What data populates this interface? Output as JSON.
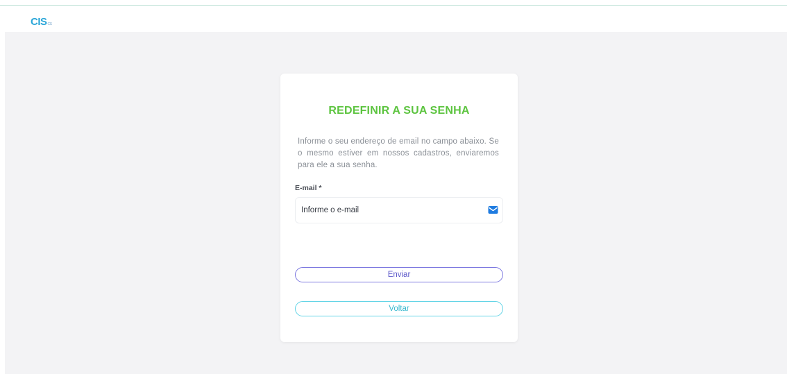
{
  "header": {
    "logo_text": "CIS",
    "logo_sub": "CS"
  },
  "card": {
    "title": "REDEFINIR A SUA SENHA",
    "description": "Informe o seu endereço de email no campo abaixo. Se o mesmo estiver em nossos cadastros, enviaremos para ele a sua senha.",
    "email_label": "E-mail *",
    "email_placeholder": "Informe o e-mail",
    "email_value": "",
    "email_icon": "envelope-icon",
    "send_label": "Enviar",
    "back_label": "Voltar"
  },
  "colors": {
    "accent_green": "#5cc43f",
    "send_border": "#7d79e0",
    "back_border": "#63d4e6",
    "icon_blue": "#1e7be0"
  }
}
